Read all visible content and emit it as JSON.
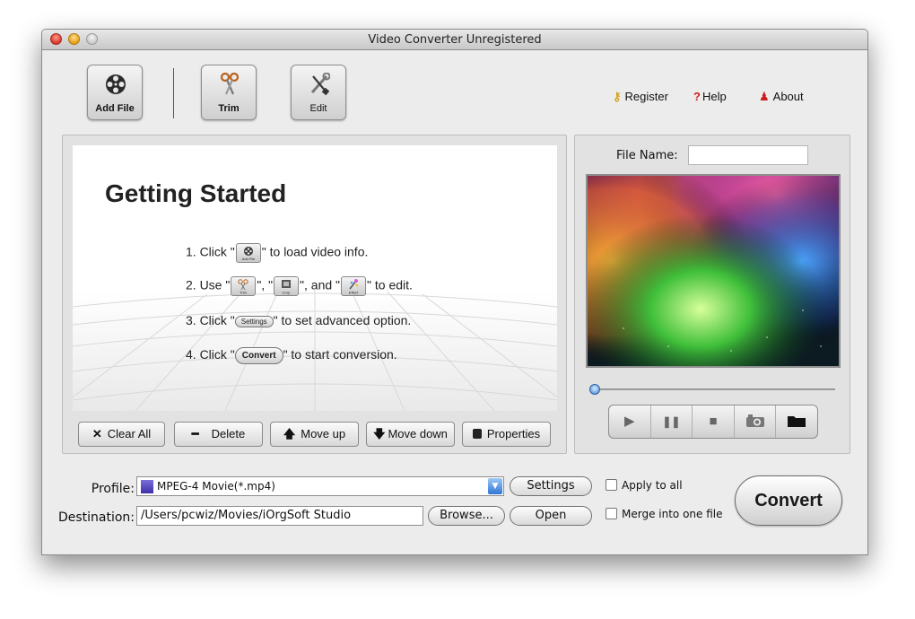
{
  "window": {
    "title": "Video Converter Unregistered"
  },
  "toolbar": {
    "add_file": "Add File",
    "trim": "Trim",
    "edit": "Edit"
  },
  "top_links": {
    "register": "Register",
    "help": "Help",
    "about": "About"
  },
  "getting_started": {
    "title": "Getting Started",
    "step1_pre": "1. Click \"",
    "step1_icon": "Add File",
    "step1_post": "\" to load video info.",
    "step2_pre": "2. Use \"",
    "step2_icon1": "Trim",
    "step2_mid1": "\", \"",
    "step2_icon2": "Crop",
    "step2_mid2": "\", and \"",
    "step2_icon3": "Effect",
    "step2_post": "\" to edit.",
    "step3_pre": "3. Click \"",
    "step3_pill": "Settings",
    "step3_post": "\" to set advanced option.",
    "step4_pre": "4. Click \"",
    "step4_pill": "Convert",
    "step4_post": "\" to start conversion."
  },
  "list_buttons": {
    "clear_all": "Clear All",
    "delete": "Delete",
    "move_up": "Move up",
    "move_down": "Move down",
    "properties": "Properties"
  },
  "preview": {
    "file_name_label": "File Name:",
    "file_name_value": ""
  },
  "player": {
    "play": "▶",
    "pause": "❚❚",
    "stop": "■",
    "snapshot": "◙",
    "folder": "▬"
  },
  "bottom": {
    "profile_label": "Profile:",
    "profile_value": "MPEG-4 Movie(*.mp4)",
    "settings": "Settings",
    "destination_label": "Destination:",
    "destination_value": "/Users/pcwiz/Movies/iOrgSoft Studio",
    "browse": "Browse...",
    "open": "Open",
    "apply_to_all": "Apply to all",
    "merge": "Merge into one file",
    "convert": "Convert"
  },
  "colors": {
    "window_bg": "#ececec",
    "panel_bg": "#e2e2e2",
    "accent_blue": "#2e76d4"
  }
}
